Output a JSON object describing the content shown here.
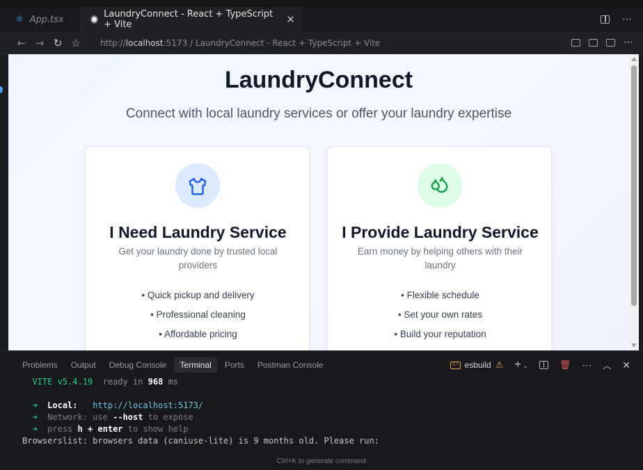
{
  "tabs": [
    {
      "label": "App.tsx",
      "icon": "react-icon"
    },
    {
      "label": "LaundryConnect - React + TypeScript + Vite",
      "icon": "globe-icon"
    }
  ],
  "address": {
    "prefix": "http://",
    "host": "localhost",
    "rest": ":5173 / LaundryConnect - React + TypeScript + Vite"
  },
  "page": {
    "title": "LaundryConnect",
    "subtitle": "Connect with local laundry services or offer your laundry expertise",
    "cards": [
      {
        "title": "I Need Laundry Service",
        "description": "Get your laundry done by trusted local providers",
        "items": [
          "• Quick pickup and delivery",
          "• Professional cleaning",
          "• Affordable pricing"
        ]
      },
      {
        "title": "I Provide Laundry Service",
        "description": "Earn money by helping others with their laundry",
        "items": [
          "• Flexible schedule",
          "• Set your own rates",
          "• Build your reputation"
        ]
      }
    ]
  },
  "panel": {
    "tabs": [
      "Problems",
      "Output",
      "Debug Console",
      "Terminal",
      "Ports",
      "Postman Console"
    ],
    "active_tab": "Terminal",
    "terminal_name": "esbuild",
    "terminal": {
      "vite_name": "VITE",
      "vite_version": "v5.4.19",
      "ready_text": "ready in",
      "ready_ms": "968",
      "ms_unit": "ms",
      "local_label": "Local:",
      "local_url": "http://localhost:5173/",
      "network_label": "Network:",
      "network_use": "use",
      "network_flag": "--host",
      "network_expose": "to expose",
      "press_text": "press",
      "press_key": "h + enter",
      "press_help": "to show help",
      "browserslist": "Browserslist: browsers data (caniuse-lite) is 9 months old. Please run:",
      "arrow": "➜"
    },
    "hint": "Ctrl+K to generate command"
  }
}
